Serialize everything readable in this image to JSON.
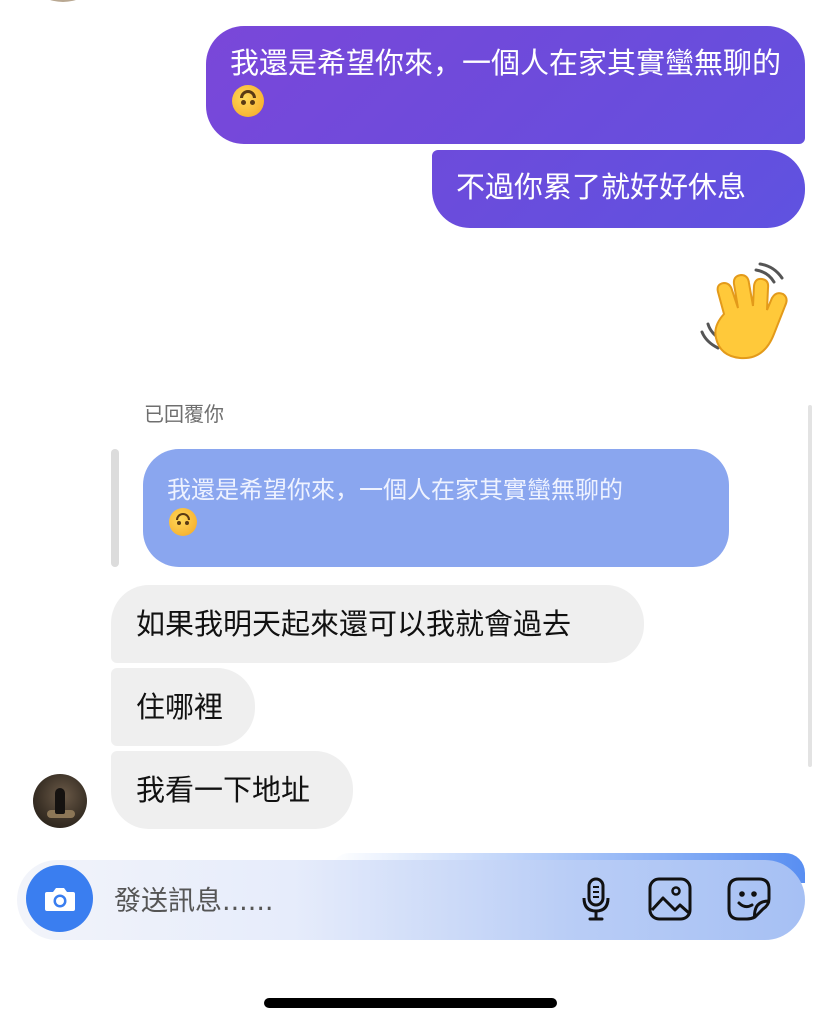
{
  "messages": {
    "sent": [
      {
        "text": "我還是希望你來，一個人在家其實蠻無聊的",
        "emoji": "upside-down-face"
      },
      {
        "text": "不過你累了就好好休息"
      }
    ],
    "sent_emoji": "waving-hand",
    "reply": {
      "label": "已回覆你",
      "quoted_text": "我還是希望你來，一個人在家其實蠻無聊的",
      "quoted_emoji": "upside-down-face"
    },
    "received": [
      {
        "text": "如果我明天起來還可以我就會過去"
      },
      {
        "text": "住哪裡"
      },
      {
        "text": "我看一下地址"
      }
    ]
  },
  "composer": {
    "placeholder": "發送訊息......",
    "icons": [
      "camera-icon",
      "microphone-icon",
      "gallery-icon",
      "sticker-icon"
    ]
  },
  "colors": {
    "sent_bubble": "#6d4bdb",
    "quoted_bubble": "#8aa6ef",
    "received_bubble": "#efefef",
    "camera_button": "#3a7ef0"
  }
}
